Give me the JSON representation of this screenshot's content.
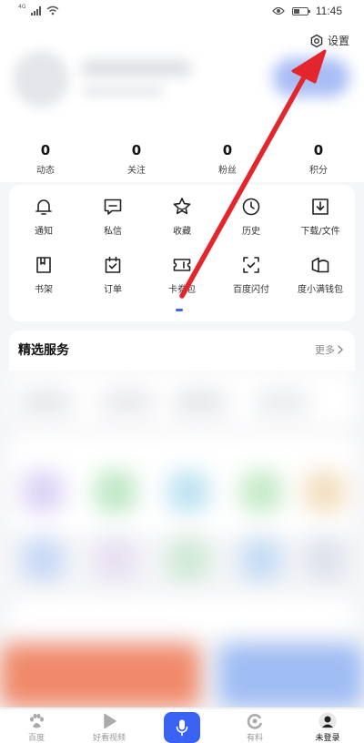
{
  "status_bar": {
    "network": "4G",
    "time": "11:45"
  },
  "settings": {
    "label": "设置",
    "icon": "gear-icon"
  },
  "stats": [
    {
      "num": "0",
      "label": "动态"
    },
    {
      "num": "0",
      "label": "关注"
    },
    {
      "num": "0",
      "label": "粉丝"
    },
    {
      "num": "0",
      "label": "积分"
    }
  ],
  "grid": [
    {
      "label": "通知",
      "icon": "bell-icon"
    },
    {
      "label": "私信",
      "icon": "message-icon"
    },
    {
      "label": "收藏",
      "icon": "star-icon"
    },
    {
      "label": "历史",
      "icon": "clock-icon"
    },
    {
      "label": "下载/文件",
      "icon": "download-icon"
    },
    {
      "label": "书架",
      "icon": "bookmark-icon"
    },
    {
      "label": "订单",
      "icon": "order-icon"
    },
    {
      "label": "卡券包",
      "icon": "ticket-icon"
    },
    {
      "label": "百度闪付",
      "icon": "scan-pay-icon"
    },
    {
      "label": "度小满钱包",
      "icon": "wallet-icon"
    }
  ],
  "services": {
    "title": "精选服务",
    "more": "更多"
  },
  "tabbar": [
    {
      "label": "百度",
      "icon": "baidu-paw-icon"
    },
    {
      "label": "好看视频",
      "icon": "play-icon"
    },
    {
      "label": "",
      "icon": "mic-icon"
    },
    {
      "label": "有料",
      "icon": "youliao-icon"
    },
    {
      "label": "未登录",
      "icon": "user-avatar-icon"
    }
  ],
  "colors": {
    "accent": "#3b63f3",
    "arrow": "#e3262b"
  }
}
